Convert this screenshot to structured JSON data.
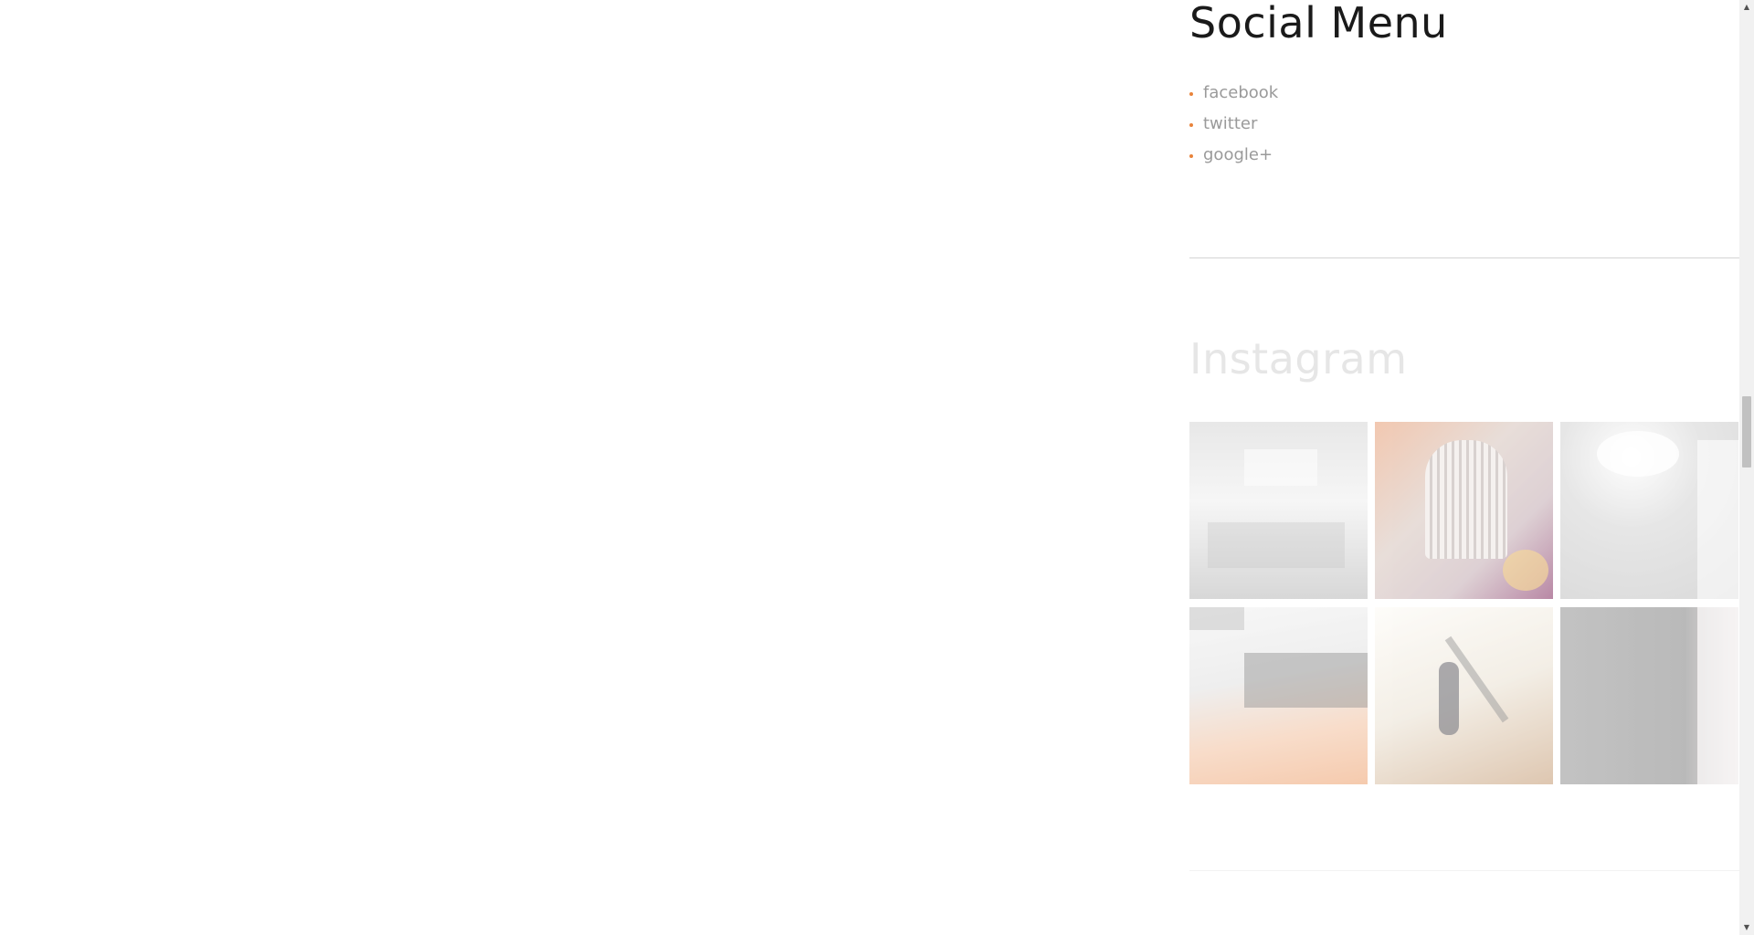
{
  "social_menu": {
    "title": "Social Menu",
    "items": [
      {
        "label": "facebook"
      },
      {
        "label": "twitter"
      },
      {
        "label": "google+"
      }
    ],
    "bullet_color": "#e8833a"
  },
  "instagram": {
    "title": "Instagram",
    "photos": [
      {
        "alt": "white interior room"
      },
      {
        "alt": "striped armchair"
      },
      {
        "alt": "light on dark surface"
      },
      {
        "alt": "white wall with orange floor"
      },
      {
        "alt": "child on wooden floor"
      },
      {
        "alt": "dark stone wall"
      }
    ]
  },
  "scrollbar": {
    "up_icon": "triangle-up",
    "down_icon": "triangle-down",
    "position_fraction": 0.44
  }
}
